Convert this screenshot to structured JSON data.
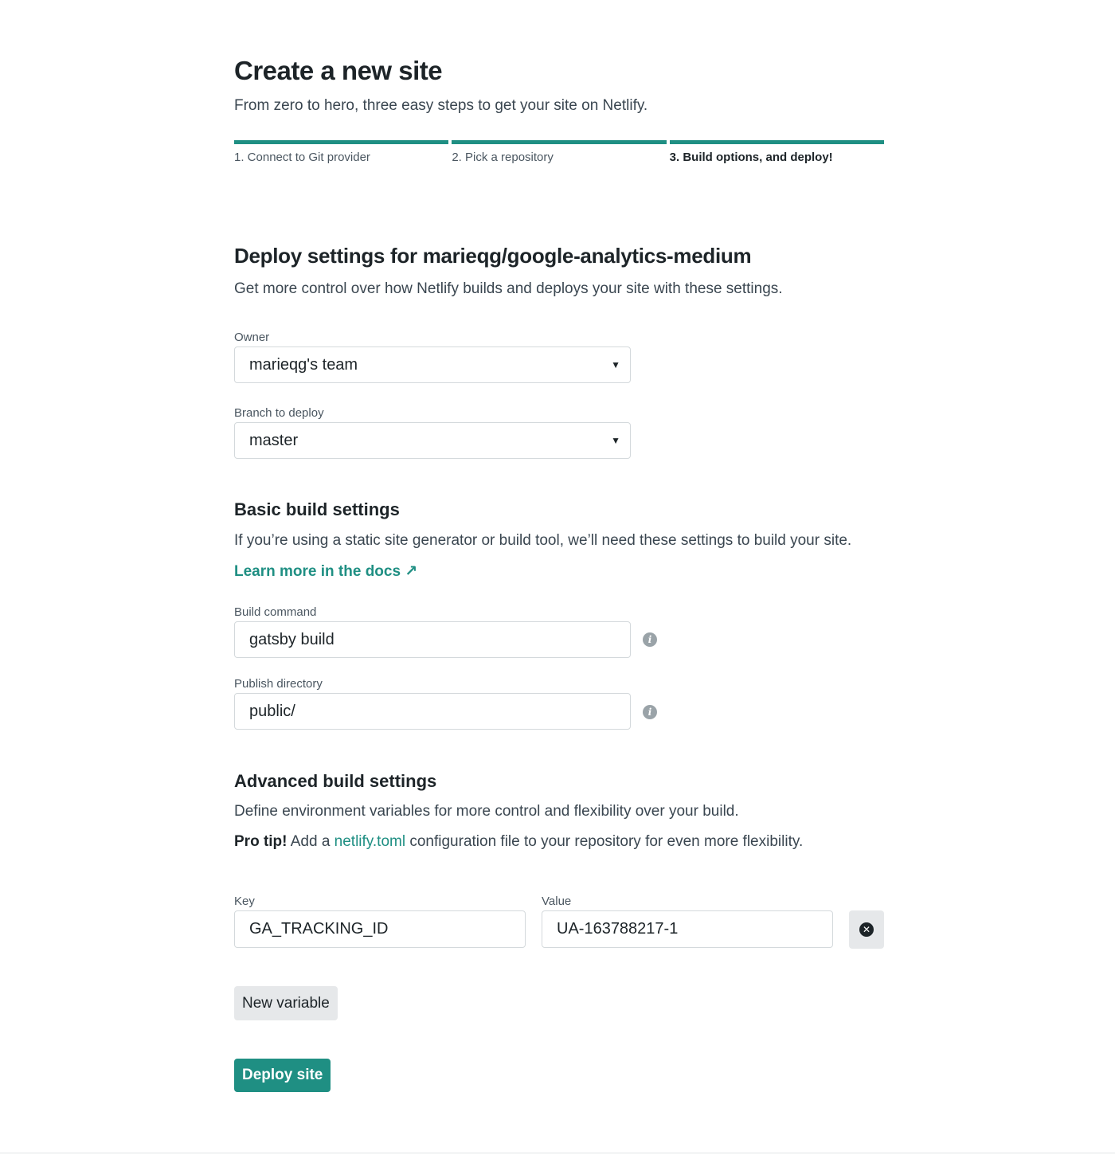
{
  "header": {
    "title": "Create a new site",
    "subtitle": "From zero to hero, three easy steps to get your site on Netlify."
  },
  "steps": [
    {
      "label": "1. Connect to Git provider",
      "active": false
    },
    {
      "label": "2. Pick a repository",
      "active": false
    },
    {
      "label": "3. Build options, and deploy!",
      "active": true
    }
  ],
  "deploy": {
    "title": "Deploy settings for marieqg/google-analytics-medium",
    "description": "Get more control over how Netlify builds and deploys your site with these settings.",
    "owner_label": "Owner",
    "owner_value": "marieqg's team",
    "branch_label": "Branch to deploy",
    "branch_value": "master"
  },
  "basic": {
    "title": "Basic build settings",
    "description": "If you’re using a static site generator or build tool, we’ll need these settings to build your site.",
    "docs_link": "Learn more in the docs",
    "docs_icon": "external-arrow-icon",
    "build_command_label": "Build command",
    "build_command_value": "gatsby build",
    "publish_dir_label": "Publish directory",
    "publish_dir_value": "public/"
  },
  "advanced": {
    "title": "Advanced build settings",
    "description": "Define environment variables for more control and flexibility over your build.",
    "protip_bold": "Pro tip!",
    "protip_pre": " Add a ",
    "protip_link": "netlify.toml",
    "protip_post": " configuration file to your repository for even more flexibility.",
    "key_label": "Key",
    "value_label": "Value",
    "variables": [
      {
        "key": "GA_TRACKING_ID",
        "value": "UA-163788217-1"
      }
    ],
    "new_variable_button": "New variable"
  },
  "actions": {
    "deploy_button": "Deploy site"
  },
  "colors": {
    "accent": "#1f8f83",
    "text": "#1d2428"
  }
}
